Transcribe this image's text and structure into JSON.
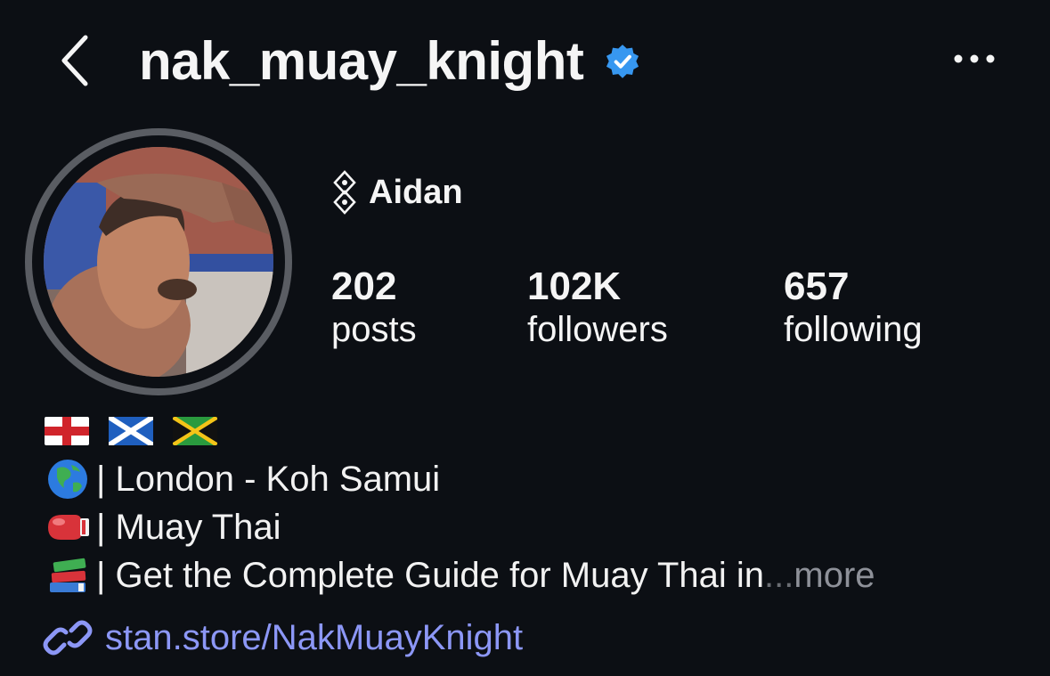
{
  "header": {
    "username": "nak_muay_knight",
    "verified": true,
    "back_icon": "chevron-left-icon",
    "more_icon": "more-horizontal-icon"
  },
  "profile": {
    "display_name": "Aidan",
    "name_icon": "threads-icon",
    "stats": [
      {
        "value": "202",
        "label": "posts"
      },
      {
        "value": "102K",
        "label": "followers"
      },
      {
        "value": "657",
        "label": "following"
      }
    ]
  },
  "bio": {
    "flags": [
      "england-flag",
      "scotland-flag",
      "jamaica-flag"
    ],
    "lines": [
      {
        "icon": "globe-icon",
        "text": "| London - Koh Samui"
      },
      {
        "icon": "boxing-glove-icon",
        "text": "| Muay Thai"
      },
      {
        "icon": "books-icon",
        "text": "| Get the Complete Guide for Muay Thai in"
      }
    ],
    "ellipsis": "...",
    "more_label": " more",
    "link": "stan.store/NakMuayKnight"
  },
  "colors": {
    "background": "#0c0f14",
    "text": "#f5f5f5",
    "muted": "#8e9199",
    "link": "#8c97f6",
    "verified": "#3797f0"
  }
}
